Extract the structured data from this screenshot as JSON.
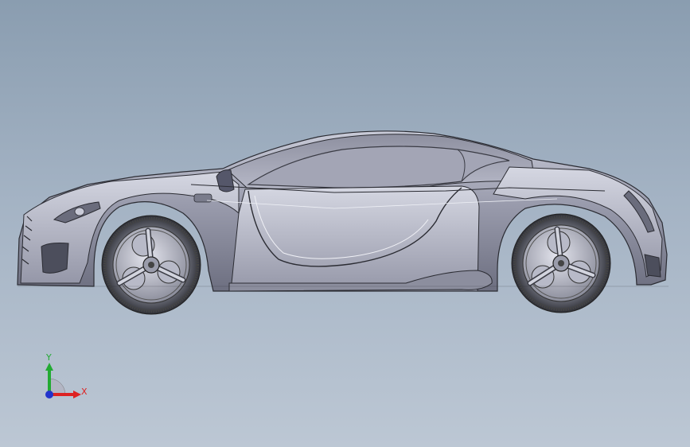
{
  "viewport": {
    "background_top": "#8a9db0",
    "background_bottom": "#bcc7d4",
    "model": "sports-car-side-view"
  },
  "triad": {
    "y_label": "Y",
    "x_label": "X",
    "y_color": "#22aa33",
    "x_color": "#dd2222",
    "z_color": "#2233cc"
  }
}
